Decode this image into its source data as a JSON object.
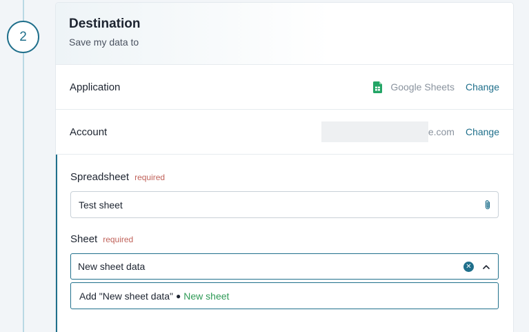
{
  "step": {
    "number": "2"
  },
  "destination": {
    "title": "Destination",
    "subtitle": "Save my data to"
  },
  "application": {
    "label": "Application",
    "value": "Google Sheets",
    "icon": "google-sheets-icon",
    "change_label": "Change"
  },
  "account": {
    "label": "Account",
    "value_visible": "e.com",
    "change_label": "Change"
  },
  "spreadsheet": {
    "label": "Spreadsheet",
    "required": "required",
    "value": "Test sheet",
    "icon": "paperclip-icon"
  },
  "sheet": {
    "label": "Sheet",
    "required": "required",
    "value": "New sheet data",
    "clear_icon": "clear-icon",
    "chevron_icon": "chevron-up-icon"
  },
  "dropdown_option": {
    "prefix": "Add \"New sheet data\"",
    "bullet": "●",
    "tag": "New sheet"
  },
  "colors": {
    "accent": "#1f6f8b",
    "required": "#c0625a",
    "new_sheet": "#2e9a56",
    "sheets_green": "#23a566"
  }
}
